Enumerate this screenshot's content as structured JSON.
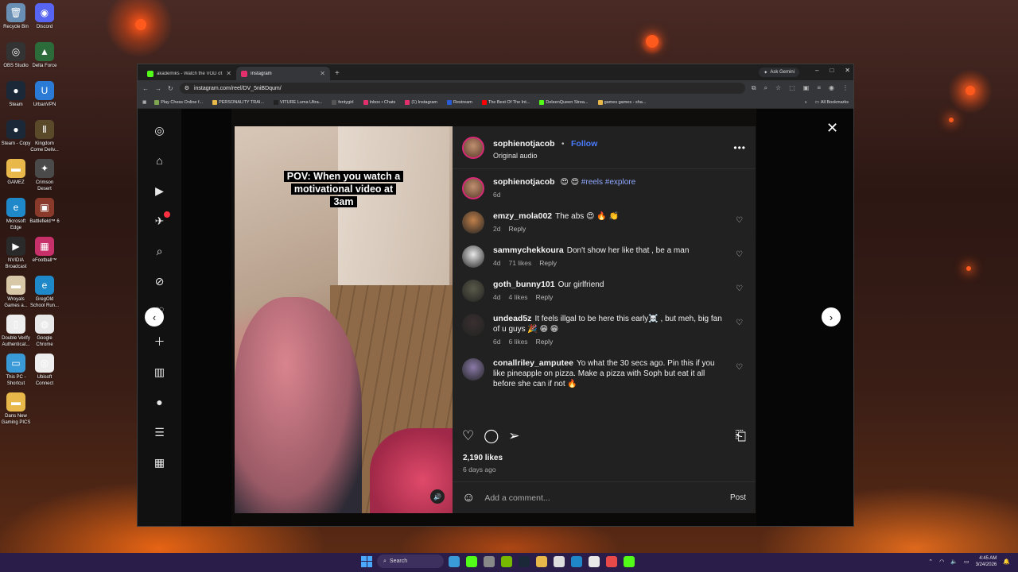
{
  "desktop": {
    "icons": [
      {
        "label": "Recycle Bin",
        "color": "#6a8fb5",
        "glyph": "🗑"
      },
      {
        "label": "Discord",
        "color": "#5865f2",
        "glyph": "◉"
      },
      {
        "label": "OBS Studio",
        "color": "#333333",
        "glyph": "◎"
      },
      {
        "label": "Delta Force",
        "color": "#2c6b3a",
        "glyph": "▲"
      },
      {
        "label": "Steam",
        "color": "#1b2838",
        "glyph": "●"
      },
      {
        "label": "UrbanVPN",
        "color": "#2a7bd6",
        "glyph": "U"
      },
      {
        "label": "Steam - Copy",
        "color": "#1b2838",
        "glyph": "●"
      },
      {
        "label": "Kingdom Come Deliv...",
        "color": "#5a4a2a",
        "glyph": "Ⅱ"
      },
      {
        "label": "GAMEZ",
        "color": "#e8b84a",
        "glyph": "▬"
      },
      {
        "label": "Crimson Desert",
        "color": "#4a4a4a",
        "glyph": "✦"
      },
      {
        "label": "Microsoft Edge",
        "color": "#1e88c8",
        "glyph": "e"
      },
      {
        "label": "Battlefield™ 6",
        "color": "#8a3a2a",
        "glyph": "▣"
      },
      {
        "label": "NVIDIA Broadcast",
        "color": "#2a2a2a",
        "glyph": "▶"
      },
      {
        "label": "eFootball™",
        "color": "#c8306a",
        "glyph": "▦"
      },
      {
        "label": "Wroyals Games a...",
        "color": "#d8c8a8",
        "glyph": "▬"
      },
      {
        "label": "GregOld School Run...",
        "color": "#1e88c8",
        "glyph": "e"
      },
      {
        "label": "Double Verify Authenticat...",
        "color": "#eeeeee",
        "glyph": "▯"
      },
      {
        "label": "Google Chrome",
        "color": "#e8e8e8",
        "glyph": "◍"
      },
      {
        "label": "This PC - Shortcut",
        "color": "#3a9ad8",
        "glyph": "▭"
      },
      {
        "label": "Ubisoft Connect",
        "color": "#eeeeee",
        "glyph": "◎"
      },
      {
        "label": "Dans New Gaming PICS",
        "color": "#e8b84a",
        "glyph": "▬"
      }
    ]
  },
  "browser": {
    "tabs": [
      {
        "title": "akademiks - Watch the VOD of...",
        "active": false,
        "favcolor": "#53fc18"
      },
      {
        "title": "Instagram",
        "active": true,
        "favcolor": "#e1306c"
      }
    ],
    "new_tab": "+",
    "ask_gemini": "Ask Gemini",
    "url": "instagram.com/reel/DV_5niBDqum/",
    "bookmarks": [
      {
        "label": "Play Chess Online f...",
        "color": "#7fa650"
      },
      {
        "label": "PERSONALITY TRAI...",
        "color": "#e8b84a"
      },
      {
        "label": "VITURE Luma Ultra...",
        "color": "#222222"
      },
      {
        "label": "fentygirl",
        "color": "#555555"
      },
      {
        "label": "Inbox • Chats",
        "color": "#e1306c"
      },
      {
        "label": "(1) Instagram",
        "color": "#e1306c"
      },
      {
        "label": "Restream",
        "color": "#2a5bd6"
      },
      {
        "label": "The Best Of The Int...",
        "color": "#ff0000"
      },
      {
        "label": "DeleenQueen Strea...",
        "color": "#53fc18"
      },
      {
        "label": "games games - sha...",
        "color": "#e8b84a"
      }
    ],
    "all_bookmarks": "All Bookmarks"
  },
  "reel": {
    "caption": "POV: When you watch a motivational video at 3am"
  },
  "post": {
    "author": "sophienotjacob",
    "separator": "•",
    "follow_label": "Follow",
    "audio": "Original audio",
    "more_label": "•••",
    "description": {
      "user": "sophienotjacob",
      "text": "😍 😍",
      "tags": "#reels #explore",
      "age": "6d"
    },
    "comments": [
      {
        "user": "emzy_mola002",
        "text": "The abs 😍 🔥 👏",
        "age": "2d",
        "likes": "",
        "reply": "Reply",
        "avatar": "#c0804a"
      },
      {
        "user": "sammychekkoura",
        "text": "Don't show her like that , be a man",
        "age": "4d",
        "likes": "71 likes",
        "reply": "Reply",
        "avatar": "#e8e8e8"
      },
      {
        "user": "goth_bunny101",
        "text": "Our girlfriend",
        "age": "4d",
        "likes": "4 likes",
        "reply": "Reply",
        "avatar": "#5a5a4a"
      },
      {
        "user": "undead5z",
        "text": "It feels illgal to be here this early☠️ , but meh, big fan of u guys 🎉 😁 😁",
        "age": "6d",
        "likes": "6 likes",
        "reply": "Reply",
        "avatar": "#3a3030"
      },
      {
        "user": "conallriley_amputee",
        "text": "Yo what the 30 secs ago. Pin this if you like pineapple on pizza. Make a pizza with Soph but eat it all before she can if not 🔥",
        "age": "",
        "likes": "",
        "reply": "",
        "avatar": "#8a7aa8"
      }
    ],
    "likes_count": "2,190 likes",
    "posted_ago": "6 days ago",
    "comment_placeholder": "Add a comment...",
    "post_label": "Post"
  },
  "taskbar": {
    "search_label": "Search",
    "time": "4:45 AM",
    "date": "3/24/2026",
    "apps": [
      "#3a9ad8",
      "#53fc18",
      "#888888",
      "#76b900",
      "#1b2838",
      "#e8b84a",
      "#dddddd",
      "#1e88c8",
      "#e8e8e8",
      "#e84a4a",
      "#53fc18"
    ]
  },
  "colors": {
    "accent_follow": "#4a7cff",
    "panel_bg": "#212121",
    "story_ring": "#d62976"
  }
}
